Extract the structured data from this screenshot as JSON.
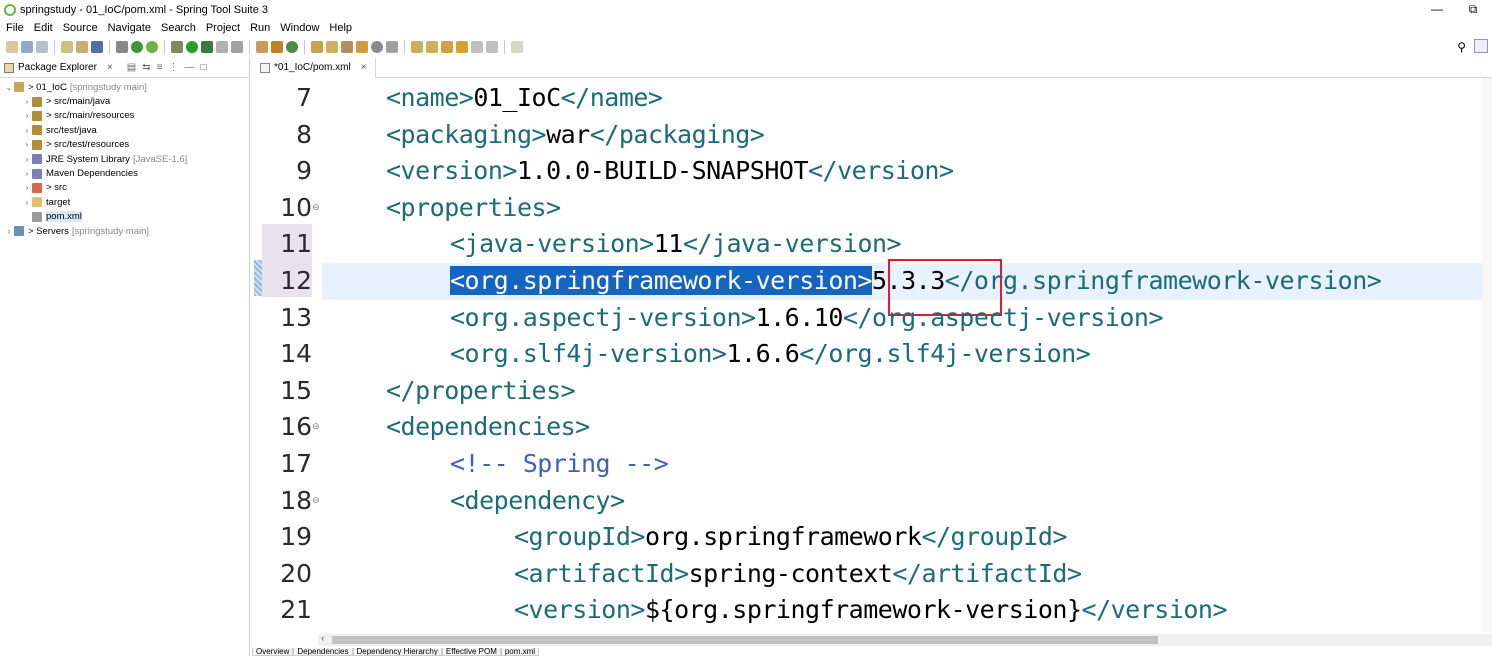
{
  "window": {
    "title": "springstudy - 01_IoC/pom.xml - Spring Tool Suite 3",
    "minimize": "—",
    "restore": "⧉"
  },
  "menu": [
    "File",
    "Edit",
    "Source",
    "Navigate",
    "Search",
    "Project",
    "Run",
    "Window",
    "Help"
  ],
  "package_explorer": {
    "tab_label": "Package Explorer",
    "items": [
      {
        "label": "> 01_IoC",
        "decor": "[springstudy main]",
        "arrow": "⌄",
        "icon_color": "#c9a45a"
      },
      {
        "label": "> src/main/java",
        "decor": "",
        "arrow": "›",
        "icon_color": "#b58b3a"
      },
      {
        "label": "> src/main/resources",
        "decor": "",
        "arrow": "›",
        "icon_color": "#b58b3a"
      },
      {
        "label": "src/test/java",
        "decor": "",
        "arrow": "›",
        "icon_color": "#b58b3a"
      },
      {
        "label": "> src/test/resources",
        "decor": "",
        "arrow": "›",
        "icon_color": "#b58b3a"
      },
      {
        "label": "JRE System Library",
        "decor": "[JavaSE-1.6]",
        "arrow": "›",
        "icon_color": "#7d7db8"
      },
      {
        "label": "Maven Dependencies",
        "decor": "",
        "arrow": "›",
        "icon_color": "#7d7db8"
      },
      {
        "label": "> src",
        "decor": "",
        "arrow": "›",
        "icon_color": "#d06a4a"
      },
      {
        "label": "target",
        "decor": "",
        "arrow": "›",
        "icon_color": "#e2c06a"
      },
      {
        "label": "pom.xml",
        "decor": "",
        "arrow": "",
        "icon_color": "#9a9a9a"
      },
      {
        "label": "> Servers",
        "decor": "[springstudy main]",
        "arrow": "›",
        "icon_color": "#6b8fb8"
      }
    ]
  },
  "editor": {
    "tab_label": "*01_IoC/pom.xml",
    "lines": [
      {
        "num": "7",
        "fold": "",
        "indent": 2,
        "parts": [
          {
            "t": "tag",
            "v": "<name>"
          },
          {
            "t": "txt",
            "v": "01_IoC"
          },
          {
            "t": "tag",
            "v": "</name>"
          }
        ]
      },
      {
        "num": "8",
        "fold": "",
        "indent": 2,
        "parts": [
          {
            "t": "tag",
            "v": "<packaging>"
          },
          {
            "t": "txt",
            "v": "war"
          },
          {
            "t": "tag",
            "v": "</packaging>"
          }
        ]
      },
      {
        "num": "9",
        "fold": "",
        "indent": 2,
        "parts": [
          {
            "t": "tag",
            "v": "<version>"
          },
          {
            "t": "txt",
            "v": "1.0.0-BUILD-SNAPSHOT"
          },
          {
            "t": "tag",
            "v": "</version>"
          }
        ]
      },
      {
        "num": "10",
        "fold": "⊖",
        "indent": 2,
        "parts": [
          {
            "t": "tag",
            "v": "<properties>"
          }
        ]
      },
      {
        "num": "11",
        "fold": "",
        "indent": 4,
        "parts": [
          {
            "t": "tag",
            "v": "<java-version>"
          },
          {
            "t": "txt",
            "v": "11"
          },
          {
            "t": "tag",
            "v": "</java-version>"
          }
        ]
      },
      {
        "num": "12",
        "fold": "",
        "indent": 4,
        "parts": [
          {
            "t": "sel",
            "v": "<org.springframework-version>"
          },
          {
            "t": "txt",
            "v": "5.3.3"
          },
          {
            "t": "tag",
            "v": "</org.springframework-version>"
          }
        ]
      },
      {
        "num": "13",
        "fold": "",
        "indent": 4,
        "parts": [
          {
            "t": "tag",
            "v": "<org.aspectj-version>"
          },
          {
            "t": "txt",
            "v": "1.6.10"
          },
          {
            "t": "tag",
            "v": "</org.aspectj-version>"
          }
        ]
      },
      {
        "num": "14",
        "fold": "",
        "indent": 4,
        "parts": [
          {
            "t": "tag",
            "v": "<org.slf4j-version>"
          },
          {
            "t": "txt",
            "v": "1.6.6"
          },
          {
            "t": "tag",
            "v": "</org.slf4j-version>"
          }
        ]
      },
      {
        "num": "15",
        "fold": "",
        "indent": 2,
        "parts": [
          {
            "t": "tag",
            "v": "</properties>"
          }
        ]
      },
      {
        "num": "16",
        "fold": "⊖",
        "indent": 2,
        "parts": [
          {
            "t": "tag",
            "v": "<dependencies>"
          }
        ]
      },
      {
        "num": "17",
        "fold": "",
        "indent": 4,
        "parts": [
          {
            "t": "cmt",
            "v": "<!-- Spring -->"
          }
        ]
      },
      {
        "num": "18",
        "fold": "⊖",
        "indent": 4,
        "parts": [
          {
            "t": "tag",
            "v": "<dependency>"
          }
        ]
      },
      {
        "num": "19",
        "fold": "",
        "indent": 6,
        "parts": [
          {
            "t": "tag",
            "v": "<groupId>"
          },
          {
            "t": "txt",
            "v": "org.springframework"
          },
          {
            "t": "tag",
            "v": "</groupId>"
          }
        ]
      },
      {
        "num": "20",
        "fold": "",
        "indent": 6,
        "parts": [
          {
            "t": "tag",
            "v": "<artifactId>"
          },
          {
            "t": "txt",
            "v": "spring-context"
          },
          {
            "t": "tag",
            "v": "</artifactId>"
          }
        ]
      },
      {
        "num": "21",
        "fold": "",
        "indent": 6,
        "parts": [
          {
            "t": "tag",
            "v": "<version>"
          },
          {
            "t": "txt",
            "v": "${org.springframework-version}"
          },
          {
            "t": "tag",
            "v": "</version>"
          }
        ]
      }
    ]
  },
  "bottom_tabs": [
    "Overview",
    "Dependencies",
    "Dependency Hierarchy",
    "Effective POM",
    "pom.xml"
  ],
  "colors": {
    "tag": "#1b6b78",
    "selection": "#1565c0",
    "highlight_box": "#e8192c",
    "current_line": "#e8f2fe"
  }
}
